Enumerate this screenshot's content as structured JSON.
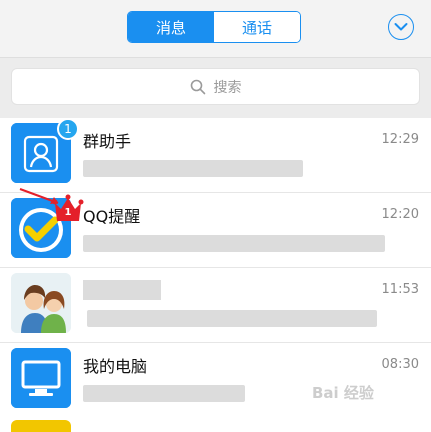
{
  "header": {
    "tabs": [
      {
        "label": "消息",
        "active": true
      },
      {
        "label": "通话",
        "active": false
      }
    ],
    "menu_icon": "chevron-down-circle-icon"
  },
  "search": {
    "placeholder": "搜索"
  },
  "conversations": [
    {
      "name": "群助手",
      "time": "12:29",
      "badge": "1",
      "avatar": "group-assistant-icon"
    },
    {
      "name": "QQ提醒",
      "time": "12:20",
      "badge": "1",
      "avatar": "qq-reminder-icon"
    },
    {
      "name": "",
      "time": "11:53",
      "badge": "",
      "avatar": "couple-avatar"
    },
    {
      "name": "我的电脑",
      "time": "08:30",
      "badge": "",
      "avatar": "my-computer-icon"
    }
  ],
  "watermark": "Bai 经验",
  "colors": {
    "accent": "#1a8ff0",
    "badge_blue": "#25a6ef",
    "crown_red": "#e4202a"
  }
}
